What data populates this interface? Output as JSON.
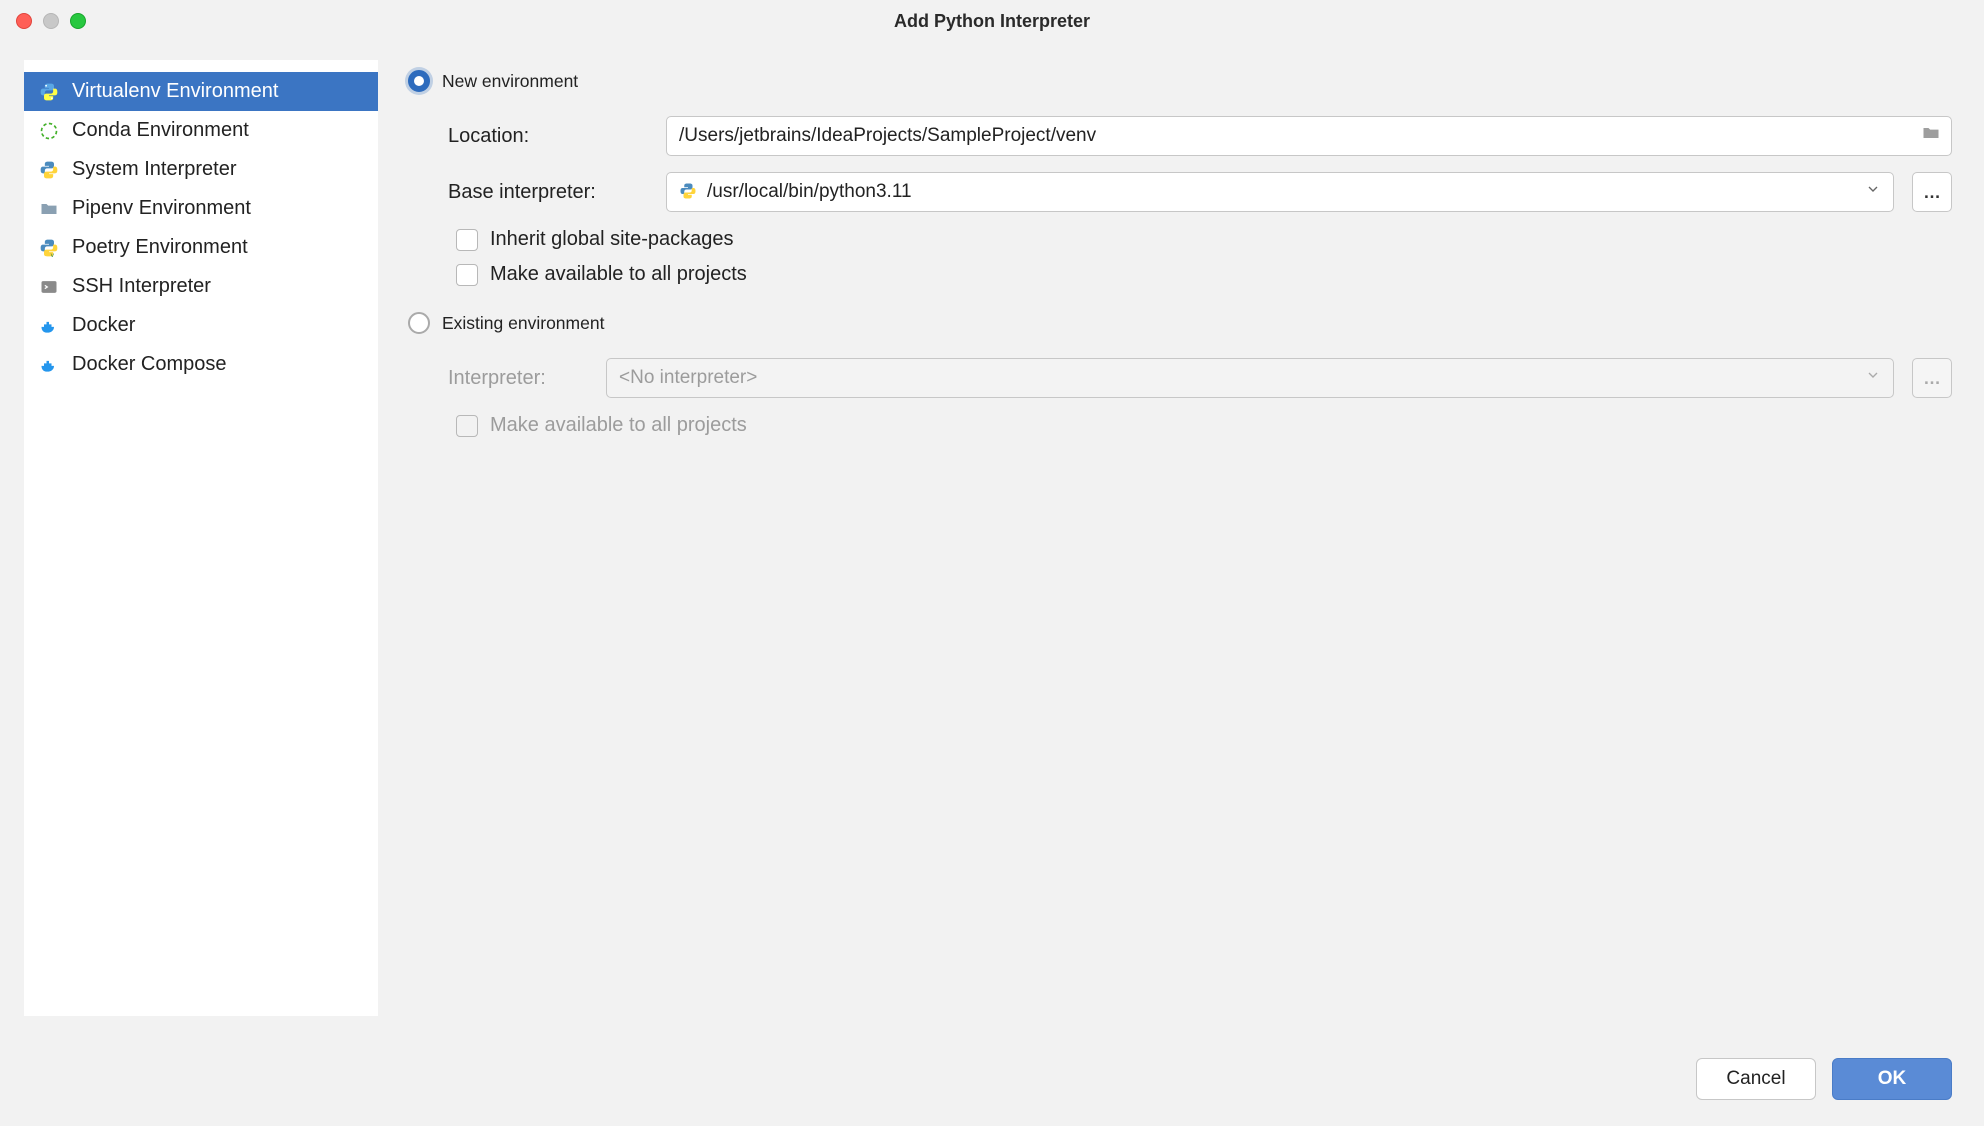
{
  "window": {
    "title": "Add Python Interpreter"
  },
  "sidebar": {
    "items": [
      {
        "label": "Virtualenv Environment",
        "icon": "python",
        "selected": true
      },
      {
        "label": "Conda Environment",
        "icon": "conda",
        "selected": false
      },
      {
        "label": "System Interpreter",
        "icon": "python",
        "selected": false
      },
      {
        "label": "Pipenv Environment",
        "icon": "folder",
        "selected": false
      },
      {
        "label": "Poetry Environment",
        "icon": "python-v",
        "selected": false
      },
      {
        "label": "SSH Interpreter",
        "icon": "ssh",
        "selected": false
      },
      {
        "label": "Docker",
        "icon": "docker",
        "selected": false
      },
      {
        "label": "Docker Compose",
        "icon": "docker",
        "selected": false
      }
    ]
  },
  "main": {
    "newEnv": {
      "radioLabel": "New environment",
      "selected": true,
      "locationLabel": "Location:",
      "locationValue": "/Users/jetbrains/IdeaProjects/SampleProject/venv",
      "baseLabel": "Base interpreter:",
      "baseValue": "/usr/local/bin/python3.11",
      "inheritLabel": "Inherit global site-packages",
      "inheritChecked": false,
      "availableLabel": "Make available to all projects",
      "availableChecked": false
    },
    "existingEnv": {
      "radioLabel": "Existing environment",
      "selected": false,
      "interpreterLabel": "Interpreter:",
      "interpreterValue": "<No interpreter>",
      "availableLabel": "Make available to all projects",
      "availableChecked": false
    }
  },
  "footer": {
    "cancel": "Cancel",
    "ok": "OK"
  }
}
